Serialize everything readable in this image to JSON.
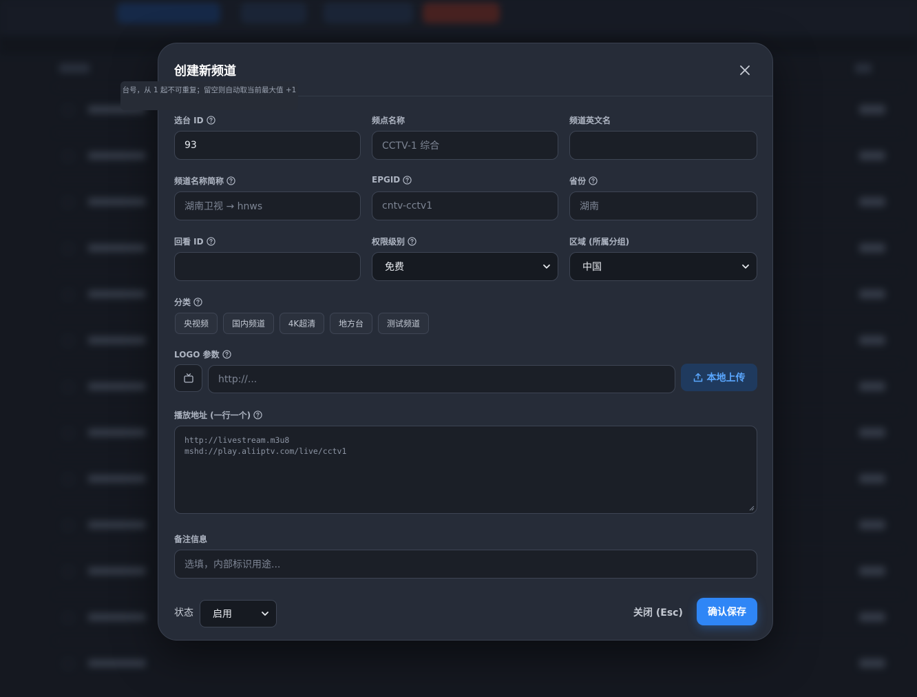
{
  "modal": {
    "title": "创建新频道",
    "close_label": "关闭 (Esc)",
    "save_label": "确认保存"
  },
  "tooltip": {
    "text": "台号，从 1 起不可重复；留空则自动取当前最大值 +1"
  },
  "fields": {
    "channel_id": {
      "label": "选台 ID",
      "value": "93"
    },
    "channel_name": {
      "label": "频点名称",
      "placeholder": "CCTV-1 综合"
    },
    "channel_en": {
      "label": "频道英文名",
      "value": ""
    },
    "short_name": {
      "label": "频道名称简称",
      "placeholder": "湖南卫视 → hnws"
    },
    "epgid": {
      "label": "EPGID",
      "placeholder": "cntv-cctv1"
    },
    "province": {
      "label": "省份",
      "placeholder": "湖南"
    },
    "playback_id": {
      "label": "回看 ID",
      "value": ""
    },
    "permission": {
      "label": "权限级别",
      "selected": "免费"
    },
    "region": {
      "label": "区域 (所属分组)",
      "selected": "中国"
    },
    "category": {
      "label": "分类",
      "tags": [
        "央视频",
        "国内频道",
        "4K超清",
        "地方台",
        "测试频道"
      ]
    },
    "logo": {
      "label": "LOGO 参数",
      "placeholder": "http://...",
      "upload_label": "本地上传"
    },
    "play_url": {
      "label": "播放地址 (一行一个)",
      "placeholder_lines": [
        "http://livestream.m3u8",
        "mshd://play.aliiptv.com/live/cctv1"
      ]
    },
    "remark": {
      "label": "备注信息",
      "placeholder": "选填，内部标识用途..."
    },
    "status": {
      "label": "状态",
      "selected": "启用"
    }
  },
  "icons": {
    "close": "close-icon",
    "help": "help-circle-icon",
    "chevron": "chevron-down-icon",
    "tv": "tv-icon",
    "upload": "upload-icon"
  },
  "colors": {
    "accent": "#2f86f6",
    "upload_text": "#5aa7ff",
    "modal_bg": "#262c38"
  }
}
